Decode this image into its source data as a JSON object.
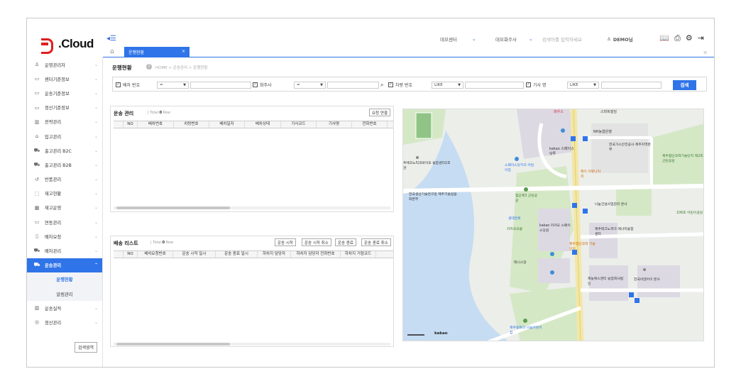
{
  "logo": {
    "text": ".Cloud",
    "accent": "#e01e1e"
  },
  "header": {
    "center": "데모센터",
    "shipper": "데모화주사",
    "search_placeholder": "검색어를 입력하세요",
    "user": "DEMO님",
    "icons": [
      "book-icon",
      "printer-icon",
      "gear-icon",
      "logout-icon"
    ]
  },
  "tabs": [
    {
      "label": "운행현황"
    }
  ],
  "sidebar": {
    "items": [
      {
        "label": "운영관리자",
        "icon": "user-icon"
      },
      {
        "label": "센터기준정보",
        "icon": "folder-icon"
      },
      {
        "label": "운송기준정보",
        "icon": "folder-icon"
      },
      {
        "label": "정산기준정보",
        "icon": "folder-icon"
      },
      {
        "label": "전략관리",
        "icon": "chart-icon"
      },
      {
        "label": "입고관리",
        "icon": "warehouse-icon"
      },
      {
        "label": "출고관리 B2C",
        "icon": "truck-icon"
      },
      {
        "label": "출고관리 B2B",
        "icon": "truck-icon"
      },
      {
        "label": "반품관리",
        "icon": "return-icon"
      },
      {
        "label": "재고현황",
        "icon": "box-icon"
      },
      {
        "label": "재고운영",
        "icon": "grid-icon"
      },
      {
        "label": "연동관리",
        "icon": "monitor-icon"
      },
      {
        "label": "배차요청",
        "icon": "doc-icon"
      },
      {
        "label": "배차관리",
        "icon": "truck-icon"
      },
      {
        "label": "운송관리",
        "icon": "truck-icon"
      }
    ],
    "sub_items": [
      {
        "label": "운행현황"
      },
      {
        "label": "알림관리"
      }
    ],
    "tail_items": [
      {
        "label": "운송실적",
        "icon": "chart-icon"
      },
      {
        "label": "정산관리",
        "icon": "coins-icon"
      }
    ],
    "search_menu_label": "검색영역"
  },
  "page": {
    "title": "운행현황",
    "breadcrumb": "HOME > 운송관리 > 운행현황"
  },
  "filter": {
    "dispatch_no_label": "배차 번호",
    "op1": "=",
    "shipper_label": "화주사",
    "op2": "=",
    "vehicle_no_label": "차량 번호",
    "op3": "LIKE",
    "driver_label": "기사 명",
    "op4": "LIKE",
    "search_label": "검색"
  },
  "transport": {
    "title": "운송 관리",
    "total_label": "Total:",
    "total_value": "0",
    "total_unit": "Row",
    "request_link_label": "요청 연결",
    "columns": [
      "NO",
      "배차번호",
      "차량번호",
      "배차일자",
      "배차상태",
      "기사코드",
      "기사명",
      "전화번호"
    ]
  },
  "delivery": {
    "title": "배송 리스트",
    "total_label": "Total:",
    "total_value": "0",
    "total_unit": "Row",
    "buttons": [
      "운송 시작",
      "운송 시작 취소",
      "운송 종료",
      "운송 종료 취소"
    ],
    "columns": [
      "NO",
      "배차요청번호",
      "운송 시작 일시",
      "운송 종료 일시",
      "하차지 담당자",
      "하차지 담당자 전화번호",
      "하차지 거점코드"
    ]
  },
  "map": {
    "labels": [
      "파우스",
      "스마트빌딩",
      "NH농협은행",
      "한국가스안전공사 제주지역본부",
      "제주첨단과학기술단지 제2호 근린공원",
      "주에코노믹코바이오 융합센터2호관",
      "kakao 스페이스닷투",
      "스페이스닷키즈 어린이집",
      "메이 커뮤니커피",
      "한국생산기술연구원 제주기술실용화본부",
      "첨단제3 근린공원",
      "나눔건설사업관리 본사",
      "106호 어린이공원",
      "생태연못",
      "카카오오름",
      "kakao 카카오 스페이스닷원",
      "제주테크노파크 에너지융합센터",
      "제주첨단과학 기술단지",
      "테니스장",
      "제농에스앤티 농업회사법인",
      "한국비엔어이 본사",
      "제주동화의 나눔어린이집",
      "kakao"
    ],
    "colors": {
      "road": "#ffffff",
      "main_road": "#f3e7a6",
      "park": "#d5e8c6",
      "water": "#c6dcf2",
      "building": "#dcd9e3"
    }
  }
}
